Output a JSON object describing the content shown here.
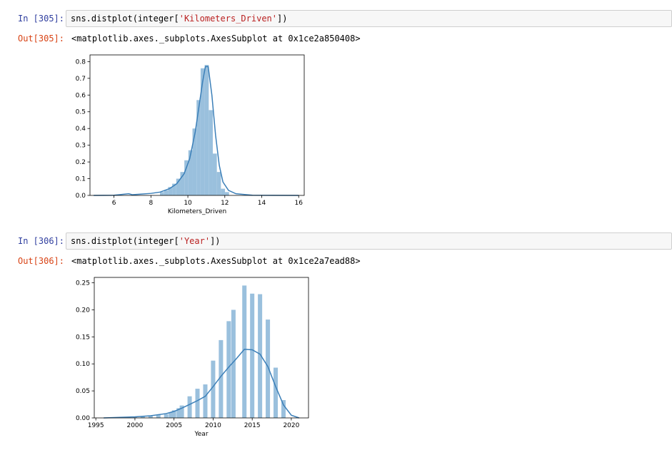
{
  "cells": [
    {
      "in_prompt": "In [305]:",
      "code_prefix": "sns.distplot(integer[",
      "code_string": "'Kilometers_Driven'",
      "code_suffix": "])",
      "out_prompt": "Out[305]:",
      "output_text": "<matplotlib.axes._subplots.AxesSubplot at 0x1ce2a850408>"
    },
    {
      "in_prompt": "In [306]:",
      "code_prefix": "sns.distplot(integer[",
      "code_string": "'Year'",
      "code_suffix": "])",
      "out_prompt": "Out[306]:",
      "output_text": "<matplotlib.axes._subplots.AxesSubplot at 0x1ce2a7ead88>"
    }
  ],
  "colors": {
    "bar_fill": "#9ac0dd",
    "kde_line": "#3b7fb8",
    "in_prompt": "#303f9f",
    "out_prompt": "#d84315",
    "string_token": "#ba2121"
  },
  "chart_data": [
    {
      "type": "bar",
      "subtype": "histogram_with_kde",
      "xlabel": "Kilometers_Driven",
      "ylabel": "",
      "xlim": [
        4.7,
        16.3
      ],
      "ylim": [
        0,
        0.84
      ],
      "xticks": [
        6,
        8,
        10,
        12,
        14,
        16
      ],
      "xtick_labels": [
        "6",
        "8",
        "10",
        "12",
        "14",
        "16"
      ],
      "yticks": [
        0.0,
        0.1,
        0.2,
        0.3,
        0.4,
        0.5,
        0.6,
        0.7,
        0.8
      ],
      "ytick_labels": [
        "0.0",
        "0.1",
        "0.2",
        "0.3",
        "0.4",
        "0.5",
        "0.6",
        "0.7",
        "0.8"
      ],
      "bin_width": 0.22,
      "bins_x": [
        8.6,
        8.82,
        9.04,
        9.26,
        9.48,
        9.7,
        9.92,
        10.14,
        10.36,
        10.58,
        10.8,
        11.02,
        11.24,
        11.46,
        11.68,
        11.9,
        12.12
      ],
      "bins_y": [
        0.02,
        0.03,
        0.05,
        0.07,
        0.1,
        0.14,
        0.21,
        0.27,
        0.4,
        0.57,
        0.76,
        0.78,
        0.51,
        0.25,
        0.14,
        0.04,
        0.02
      ],
      "kde_x": [
        4.9,
        6.0,
        6.8,
        7.0,
        7.5,
        8.0,
        8.5,
        9.0,
        9.4,
        9.8,
        10.1,
        10.4,
        10.6,
        10.8,
        10.95,
        11.1,
        11.3,
        11.5,
        11.7,
        11.9,
        12.2,
        12.6,
        13.5,
        16.0
      ],
      "kde_y": [
        0.0,
        0.001,
        0.01,
        0.004,
        0.008,
        0.012,
        0.02,
        0.04,
        0.07,
        0.13,
        0.22,
        0.38,
        0.53,
        0.68,
        0.77,
        0.77,
        0.6,
        0.36,
        0.18,
        0.08,
        0.03,
        0.01,
        0.001,
        0.0
      ]
    },
    {
      "type": "bar",
      "subtype": "histogram_with_kde",
      "xlabel": "Year",
      "ylabel": "",
      "xlim": [
        1994.8,
        2022.2
      ],
      "ylim": [
        0,
        0.26
      ],
      "xticks": [
        1995,
        2000,
        2005,
        2010,
        2015,
        2020
      ],
      "xtick_labels": [
        "1995",
        "2000",
        "2005",
        "2010",
        "2015",
        "2020"
      ],
      "yticks": [
        0.0,
        0.05,
        0.1,
        0.15,
        0.2,
        0.25
      ],
      "ytick_labels": [
        "0.00",
        "0.05",
        "0.10",
        "0.15",
        "0.20",
        "0.25"
      ],
      "bin_width": 0.55,
      "bins_x": [
        1998,
        2000,
        2001,
        2002,
        2003,
        2004,
        2004.6,
        2005,
        2005.6,
        2006,
        2007,
        2008,
        2009,
        2010,
        2011,
        2012,
        2012.6,
        2014,
        2015,
        2016,
        2017,
        2018,
        2019
      ],
      "bins_y": [
        0.001,
        0.002,
        0.003,
        0.004,
        0.006,
        0.007,
        0.01,
        0.014,
        0.018,
        0.023,
        0.04,
        0.054,
        0.062,
        0.106,
        0.144,
        0.179,
        0.2,
        0.245,
        0.23,
        0.229,
        0.182,
        0.093,
        0.033
      ],
      "kde_x": [
        1996,
        1998,
        2000,
        2002,
        2004,
        2005,
        2006,
        2007,
        2008,
        2009,
        2010,
        2011,
        2012,
        2013,
        2014,
        2015,
        2016,
        2017,
        2018,
        2019,
        2020,
        2021
      ],
      "kde_y": [
        0.0,
        0.001,
        0.002,
        0.004,
        0.008,
        0.012,
        0.018,
        0.025,
        0.032,
        0.04,
        0.058,
        0.077,
        0.094,
        0.11,
        0.127,
        0.126,
        0.118,
        0.095,
        0.058,
        0.024,
        0.005,
        0.0
      ]
    }
  ]
}
